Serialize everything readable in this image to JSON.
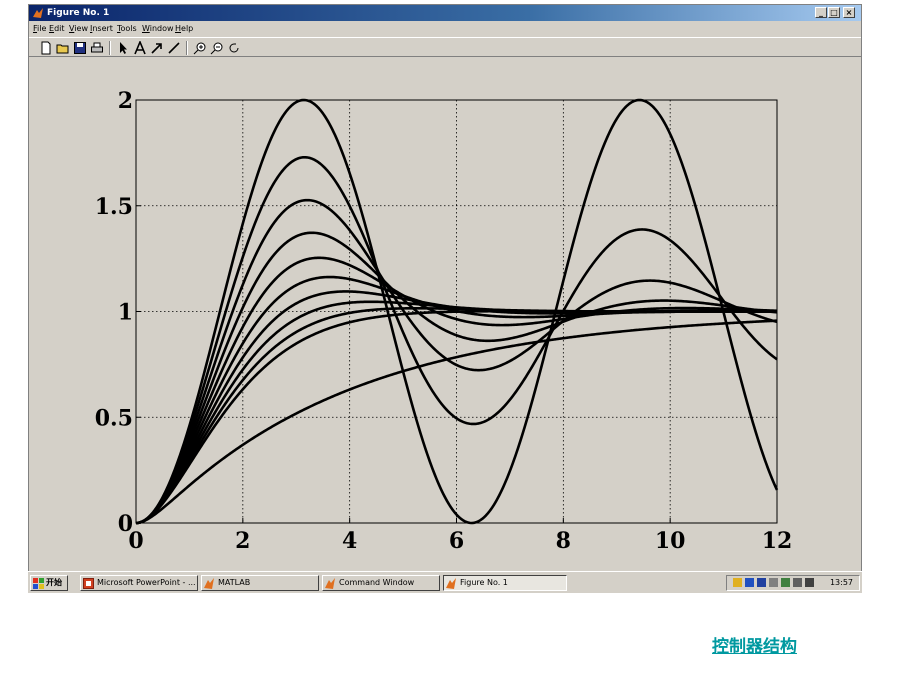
{
  "window": {
    "title": "Figure No. 1",
    "menu": [
      {
        "label": "File",
        "key": "F"
      },
      {
        "label": "Edit",
        "key": "E"
      },
      {
        "label": "View",
        "key": "V"
      },
      {
        "label": "Insert",
        "key": "I"
      },
      {
        "label": "Tools",
        "key": "T"
      },
      {
        "label": "Window",
        "key": "W"
      },
      {
        "label": "Help",
        "key": "H"
      }
    ],
    "toolbar_icons": [
      "new-file-icon",
      "open-folder-icon",
      "save-icon",
      "print-icon",
      "select-arrow-icon",
      "insert-text-icon",
      "insert-arrow-icon",
      "insert-line-icon",
      "zoom-in-icon",
      "zoom-out-icon",
      "rotate-icon"
    ]
  },
  "chart_data": {
    "type": "line",
    "title": "",
    "xlabel": "",
    "ylabel": "",
    "xlim": [
      0,
      12
    ],
    "ylim": [
      0,
      2
    ],
    "xticks": [
      "0",
      "2",
      "4",
      "6",
      "8",
      "10",
      "12"
    ],
    "yticks": [
      "0",
      "0.5",
      "1",
      "1.5",
      "2"
    ],
    "grid": true,
    "series_description": "step responses of second-order system, zeta = 0, 0.1, 0.2, ... 0.9, 2.0",
    "zetas": [
      0,
      0.1,
      0.2,
      0.3,
      0.4,
      0.5,
      0.6,
      0.7,
      0.8,
      0.9,
      2.0
    ],
    "wn": 1,
    "line_color": "#000000"
  },
  "taskbar": {
    "start_label": "开始",
    "tasks": [
      {
        "label": "Microsoft PowerPoint - ...",
        "icon": "powerpoint-icon"
      },
      {
        "label": "MATLAB",
        "icon": "matlab-icon"
      },
      {
        "label": "Command Window",
        "icon": "matlab-icon"
      },
      {
        "label": "Figure No. 1",
        "icon": "matlab-figure-icon"
      }
    ],
    "tray_icons": [
      "pen-icon",
      "speaker-icon",
      "ch-input-icon",
      "keyboard-icon",
      "network-icon",
      "printer-icon",
      "window-icon"
    ],
    "time": "13:57"
  },
  "caption": "控制器结构"
}
